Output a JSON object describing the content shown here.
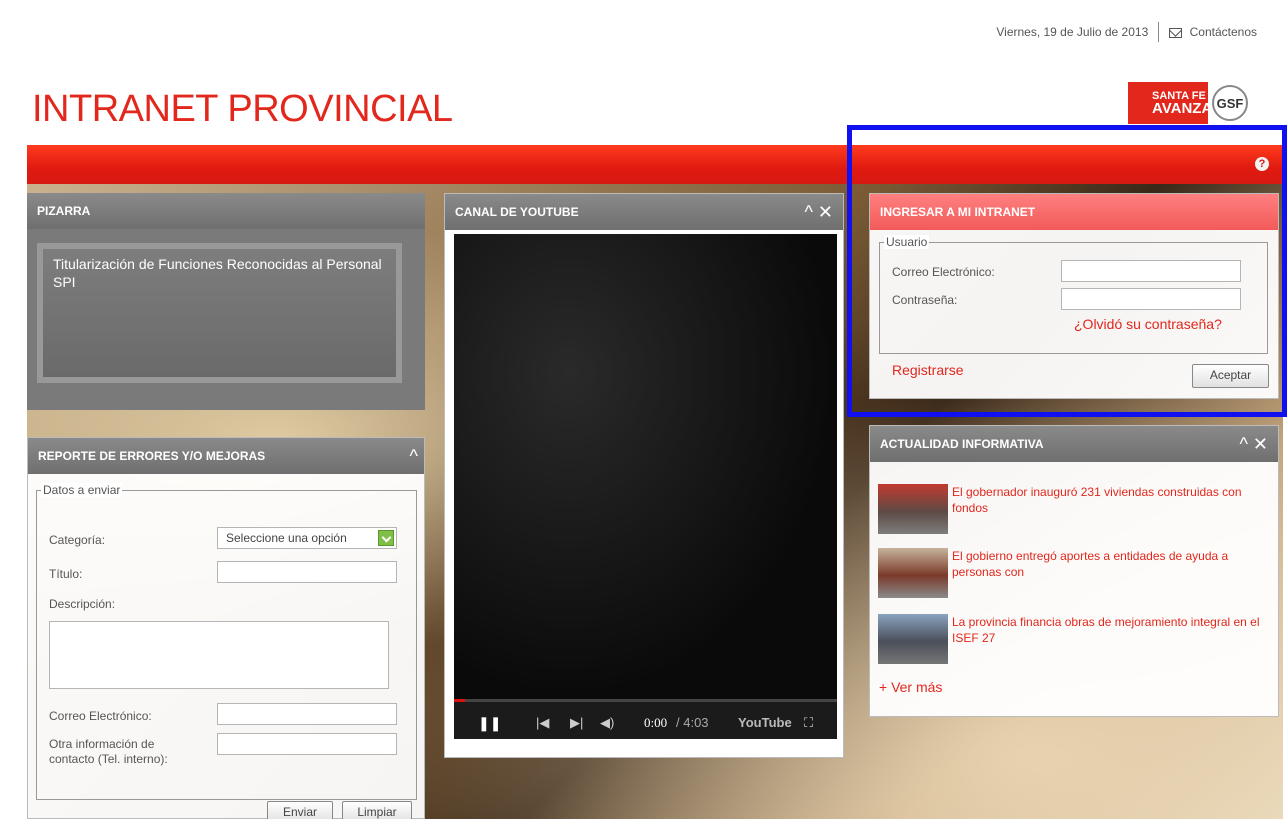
{
  "header": {
    "date": "Viernes, 19 de Julio de 2013",
    "contact_label": "Contáctenos",
    "title": "INTRANET PROVINCIAL",
    "logo_sf_line1": "SANTA FE",
    "logo_sf_line2": "AVANZA",
    "logo_gsf": "GSF",
    "help_icon": "?"
  },
  "pizarra": {
    "title": "PIZARRA",
    "text": "Titularización de Funciones Reconocidas al Personal SPI"
  },
  "reporte": {
    "title": "REPORTE DE ERRORES Y/O MEJORAS",
    "legend": "Datos a enviar",
    "categoria_label": "Categoría:",
    "categoria_value": "Seleccione una opción",
    "titulo_label": "Título:",
    "descripcion_label": "Descripción:",
    "correo_label": "Correo Electrónico:",
    "otra_label_1": "Otra información de",
    "otra_label_2": "contacto (Tel. interno):",
    "enviar": "Enviar",
    "limpiar": "Limpiar",
    "collapse_icon": "^"
  },
  "youtube": {
    "title": "CANAL DE YOUTUBE",
    "controls": "^ ✕",
    "time_current": "0:00",
    "time_total": "/ 4:03",
    "logo": "YouTube",
    "progress": 0.03
  },
  "login": {
    "title": "INGRESAR A MI INTRANET",
    "legend": "Usuario",
    "email_label": "Correo Electrónico:",
    "password_label": "Contraseña:",
    "forgot": "¿Olvidó su contraseña?",
    "register": "Registrarse",
    "accept": "Aceptar"
  },
  "news": {
    "title": "ACTUALIDAD INFORMATIVA",
    "controls": "^ ✕",
    "items": [
      {
        "text": "El gobernador inauguró 231 viviendas construidas con fondos"
      },
      {
        "text": "El gobierno entregó aportes a entidades de ayuda a personas con"
      },
      {
        "text": "La provincia financia obras de mejoramiento integral en el ISEF 27"
      }
    ],
    "more": "+ Ver más"
  },
  "colors": {
    "brand_red": "#e2271d",
    "highlight_blue": "#1010f0"
  }
}
